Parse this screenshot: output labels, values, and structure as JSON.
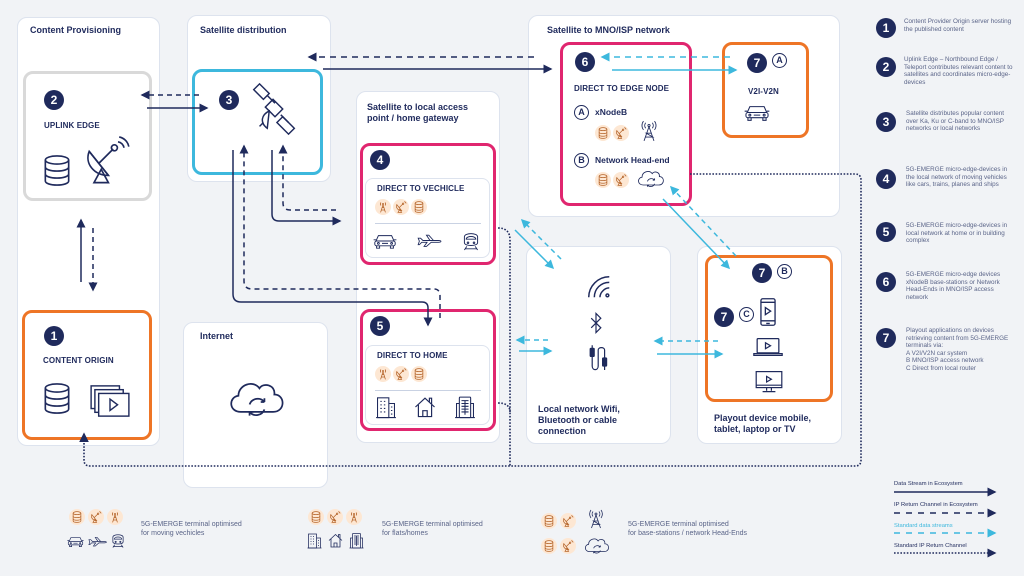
{
  "panels": {
    "content_provisioning": "Content Provisioning",
    "satellite_distribution": "Satellite distribution",
    "satellite_local": "Satellite to local access point / home gateway",
    "satellite_mno": "Satellite to MNO/ISP network",
    "internet": "Internet",
    "local_network": "Local network Wifi, Bluetooth or cable connection",
    "playout": "Playout device mobile, tablet, laptop or TV"
  },
  "nodes": {
    "uplink": {
      "number": "2",
      "label": "UPLINK EDGE"
    },
    "origin": {
      "number": "1",
      "label": "CONTENT ORIGIN"
    },
    "satellite": {
      "number": "3"
    },
    "vehicle": {
      "number": "4",
      "label": "DIRECT TO VECHICLE"
    },
    "home": {
      "number": "5",
      "label": "DIRECT TO HOME"
    },
    "edge": {
      "number": "6",
      "label": "DIRECT TO EDGE NODE",
      "a_letter": "A",
      "a_label": "xNodeB",
      "b_letter": "B",
      "b_label": "Network Head-end"
    },
    "v2x": {
      "number": "7",
      "letter": "A",
      "label": "V2I-V2N"
    },
    "playout_b": {
      "number": "7",
      "letter": "B"
    },
    "playout_c": {
      "number": "7",
      "letter": "C"
    }
  },
  "legend": [
    {
      "number": "1",
      "text": "Content Provider Origin server hosting the published content"
    },
    {
      "number": "2",
      "text": "Uplink Edge – Northbound Edge / Teleport contributes relevant content to satellites and coordinates micro-edge-devices"
    },
    {
      "number": "3",
      "text": "Satellite distributes popular content over Ka, Ku or C-band to MNO/ISP networks or local networks"
    },
    {
      "number": "4",
      "text": "5G-EMERGE micro-edge-devices in the local network of moving vehicles like cars, trains, planes and ships"
    },
    {
      "number": "5",
      "text": "5G-EMERGE micro-edge-devices in local network at home or in building complex"
    },
    {
      "number": "6",
      "text": "5G-EMERGE micro-edge devices xNodeB base-stations or Network Head-Ends in MNO/ISP access network"
    },
    {
      "number": "7",
      "text": "Playout applications on devices retrieving content from 5G-EMERGE terminals via:\nA V2I/V2N car system\nB MNO/ISP access network\nC Direct from local router"
    }
  ],
  "footer": {
    "terminal_vehicles": "5G-EMERGE terminal optimised\nfor moving vechicles",
    "terminal_homes": "5G-EMERGE terminal optimised\nfor flats/homes",
    "terminal_base": "5G-EMERGE terminal optimised\nfor base-stations / network Head-Ends"
  },
  "line_key": [
    {
      "label": "Data Stream in Ecosystem",
      "style": "solid",
      "color": "#1f2a5c"
    },
    {
      "label": "IP Return Channel in Ecosystem",
      "style": "dashed",
      "color": "#1f2a5c"
    },
    {
      "label": "Standard data streams",
      "style": "dashed",
      "color": "#3db8dd"
    },
    {
      "label": "Standard IP Return Channel",
      "style": "dotted",
      "color": "#1f2a5c"
    }
  ],
  "colors": {
    "navy": "#1f2a5c",
    "cyan": "#3db8dd",
    "pink": "#e0266f",
    "orange": "#ee7526",
    "gray": "#d9d9d9",
    "chip": "#fde7d3"
  }
}
